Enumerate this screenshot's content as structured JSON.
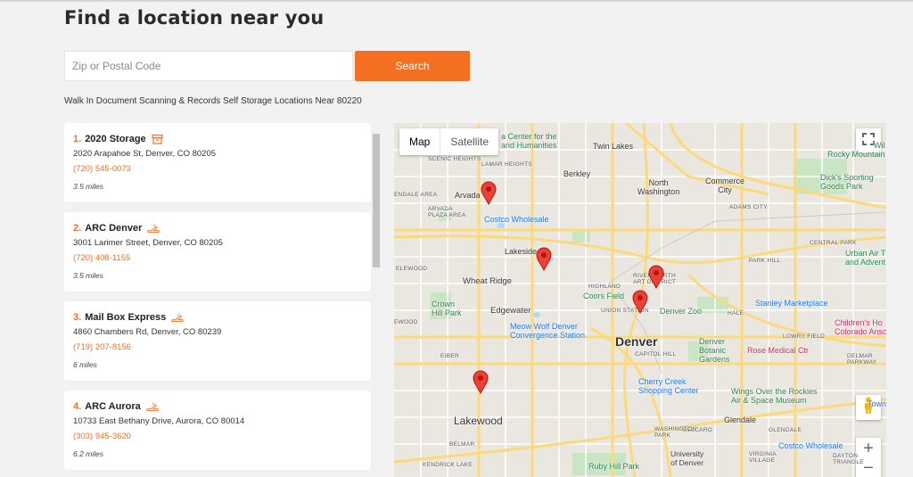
{
  "header": {
    "title": "Find a location near you"
  },
  "search": {
    "placeholder": "Zip or Postal Code",
    "value": "",
    "button_label": "Search"
  },
  "results": {
    "summary": "Walk In Document Scanning & Records Self Storage Locations Near 80220",
    "items": [
      {
        "number": "1.",
        "name": "2020 Storage",
        "badge_icon": "box-icon",
        "address": "2020 Arapahoe St, Denver, CO 80205",
        "phone": "(720) 545-0073",
        "distance": "3.5 miles"
      },
      {
        "number": "2.",
        "name": "ARC Denver",
        "badge_icon": "hand-icon",
        "address": "3001 Larimer Street, Denver, CO 80205",
        "phone": "(720) 408-1155",
        "distance": "3.5 miles"
      },
      {
        "number": "3.",
        "name": "Mail Box Express",
        "badge_icon": "hand-icon",
        "address": "4860 Chambers Rd, Denver, CO 80239",
        "phone": "(719) 207-8156",
        "distance": "6 miles"
      },
      {
        "number": "4.",
        "name": "ARC Aurora",
        "badge_icon": "hand-icon",
        "address": "10733 East Bethany Drive, Aurora, CO 80014",
        "phone": "(303) 945-3620",
        "distance": "6.2 miles"
      }
    ]
  },
  "map": {
    "type_buttons": {
      "map": "Map",
      "satellite": "Satellite"
    },
    "controls": {
      "zoom_in": "+",
      "zoom_out": "−"
    },
    "labels": {
      "denver": "Denver",
      "lakewood": "Lakewood",
      "arvada": "Arvada",
      "wheat_ridge": "Wheat Ridge",
      "edgewater": "Edgewater",
      "lakeside": "Lakeside",
      "berkley": "Berkley",
      "twin_lakes": "Twin Lakes",
      "north_washington": "North\nWashington",
      "commerce_city": "Commerce\nCity",
      "glendale": "Glendale",
      "crown_hill": "Crown\nHill Park",
      "coors_field": "Coors Field",
      "denver_zoo": "Denver Zoo",
      "stanley": "Stanley Marketplace",
      "rose": "Rose Medical Ctr",
      "cherry_creek": "Cherry Creek\nShopping Center",
      "botanic": "Denver\nBotanic\nGardens",
      "wings": "Wings Over the Rockies\nAir & Space Museum",
      "costco1": "Costco Wholesale",
      "costco2": "Costco Wholesale",
      "meow_wolf": "Meow Wolf Denver\nConvergence Station",
      "ruby_hill": "Ruby Hill Park",
      "university": "University\nof Denver",
      "dicks": "Dick's Sporting\nGoods Park",
      "rocky": "Wil\nRocky Mountain",
      "urban_air": "Urban Air T\nand Advent",
      "childrens": "Children's Ho\nColorado Ansc",
      "town_center": "Town",
      "center_arts": "a Center for the\nand Humanities",
      "rino": "RIVER NORTH\nART DISTRICT",
      "union_station": "UNION STATION",
      "capitol_hill": "CAPITOL HILL",
      "highland": "HIGHLAND",
      "scenic_heights": "SCENIC HEIGHTS",
      "lamar_heights": "LAMAR HEIGHTS",
      "arvada_plaza": "ARVADA\nPLAZA AREA",
      "wellshire": "WASHINGTON\nPARK",
      "central_park": "CENTRAL PARK",
      "park_hill": "PARK HILL",
      "adams": "ADAMS CITY",
      "eiber": "EIBER",
      "kendrick": "KENDRICK LAKE",
      "belcaro": "BELCARO",
      "virginia": "VIRGINIA\nVILLAGE",
      "lowry": "LOWRY FIELD",
      "delmar": "DELMAR\nPARKWAY",
      "dayton": "DAYTON\nTRIANGLE",
      "hale": "HALE",
      "elewood": "ELEWOOD",
      "endale": "ENDALE AREA",
      "ewood": "EWOOD",
      "washington_park": "WASHINGTON\nPARK",
      "belmar": "BELMAR",
      "glendale_area": "GLENDALE"
    }
  }
}
